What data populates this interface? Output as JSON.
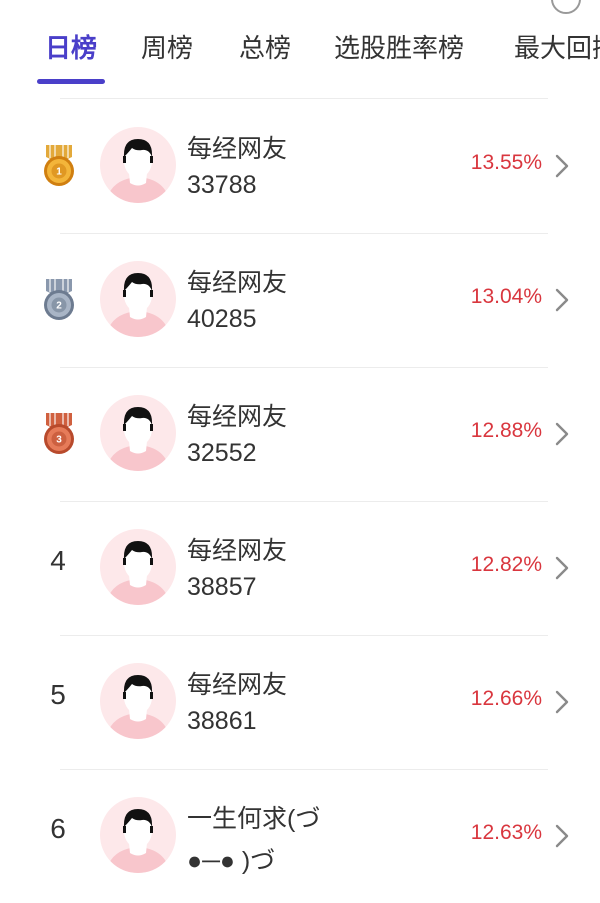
{
  "tabs": [
    {
      "label": "日榜",
      "active": true
    },
    {
      "label": "周榜",
      "active": false
    },
    {
      "label": "总榜",
      "active": false
    },
    {
      "label": "选股胜率榜",
      "active": false
    },
    {
      "label": "最大回撤",
      "active": false
    }
  ],
  "colors": {
    "accent": "#4a3fc9",
    "percent": "#d9363e",
    "gold": "#e79a1e",
    "silver": "#8a98ad",
    "bronze": "#d0603f"
  },
  "ranking": [
    {
      "rank": "1",
      "medal": "gold",
      "name": "每经网友",
      "id": "33788",
      "percent": "13.55%"
    },
    {
      "rank": "2",
      "medal": "silver",
      "name": "每经网友",
      "id": "40285",
      "percent": "13.04%"
    },
    {
      "rank": "3",
      "medal": "bronze",
      "name": "每经网友",
      "id": "32552",
      "percent": "12.88%"
    },
    {
      "rank": "4",
      "medal": null,
      "name": "每经网友",
      "id": "38857",
      "percent": "12.82%"
    },
    {
      "rank": "5",
      "medal": null,
      "name": "每经网友",
      "id": "38861",
      "percent": "12.66%"
    },
    {
      "rank": "6",
      "medal": null,
      "name": "一生何求(づ",
      "id": "●─● )づ",
      "percent": "12.63%"
    }
  ]
}
